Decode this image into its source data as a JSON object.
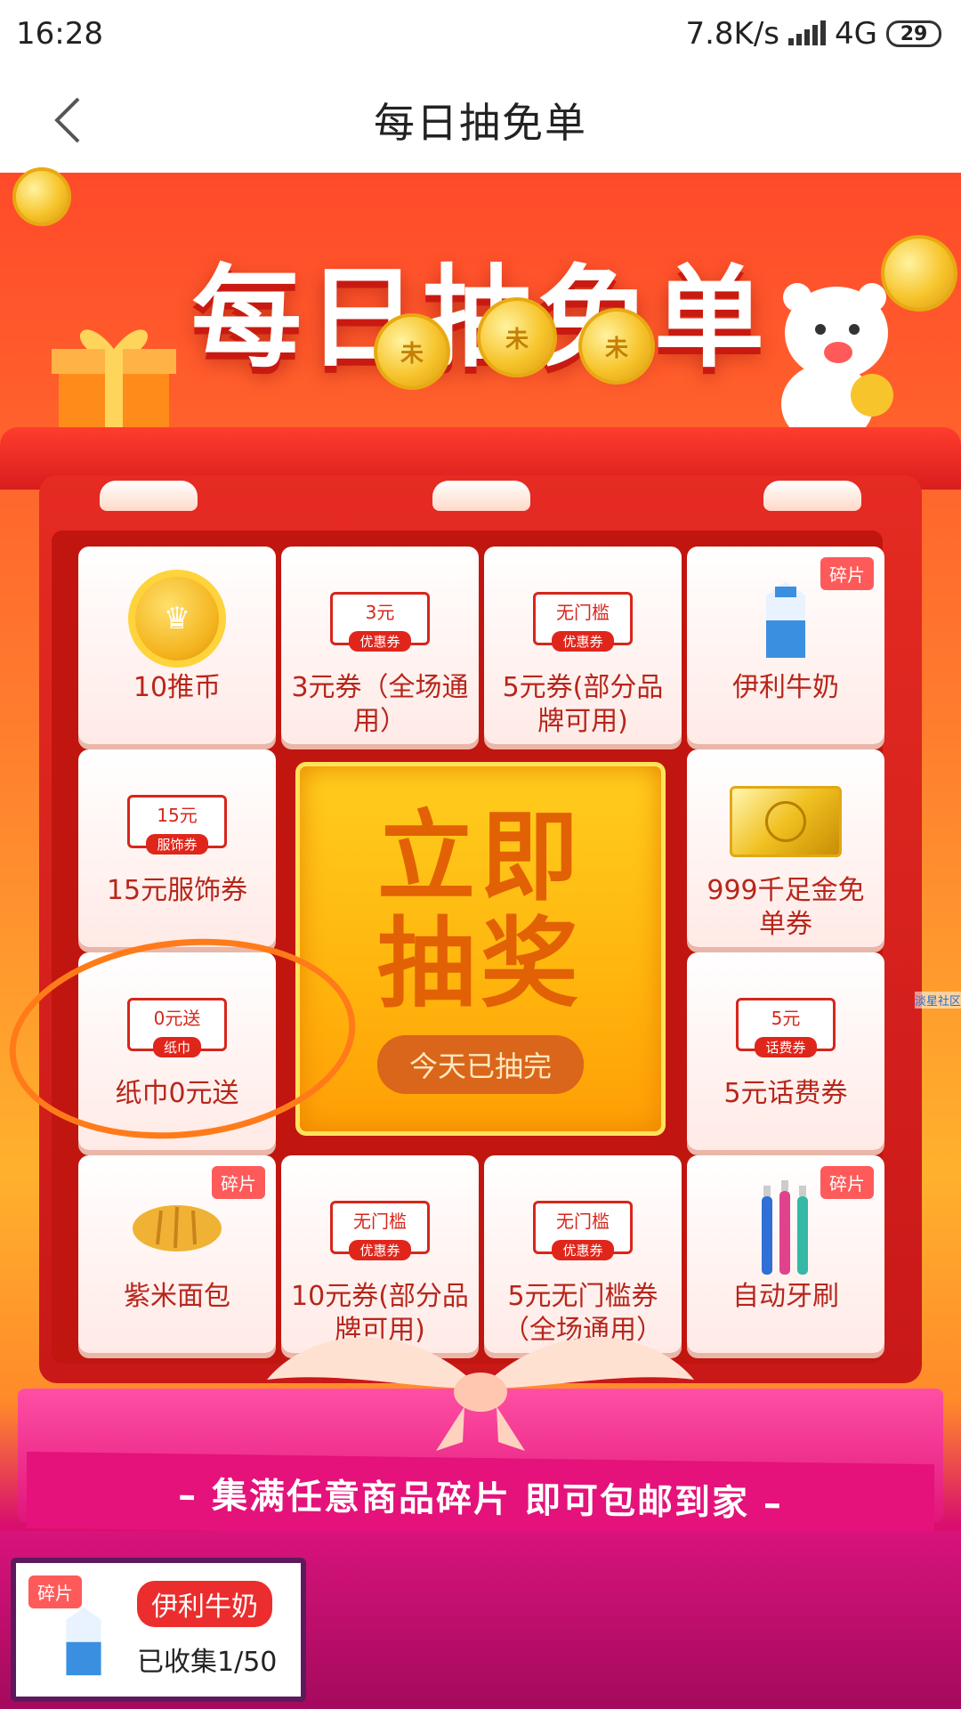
{
  "status_bar": {
    "time": "16:28",
    "speed": "7.8K/s",
    "network": "4G",
    "battery": "29"
  },
  "nav": {
    "title": "每日抽免单"
  },
  "hero": {
    "title": "每日抽免单",
    "coin_mark": "未"
  },
  "center": {
    "line1": "立即",
    "line2": "抽奖",
    "status": "今天已抽完"
  },
  "prizes": [
    {
      "label": "10推币"
    },
    {
      "label": "3元券（全场通用）",
      "ticket_top": "3元",
      "ticket_bottom": "优惠券"
    },
    {
      "label": "5元券(部分品牌可用)",
      "ticket_top": "无门槛",
      "ticket_bottom": "优惠券"
    },
    {
      "label": "伊利牛奶",
      "badge": "碎片"
    },
    {
      "label": "15元服饰券",
      "ticket_top": "15元",
      "ticket_bottom": "服饰券"
    },
    {
      "label": "999千足金免单券"
    },
    {
      "label": "纸巾0元送",
      "ticket_top": "0元送",
      "ticket_bottom": "纸巾"
    },
    {
      "label": "5元话费券",
      "ticket_top": "5元",
      "ticket_bottom": "话费券"
    },
    {
      "label": "紫米面包",
      "badge": "碎片"
    },
    {
      "label": "10元券(部分品牌可用)",
      "ticket_top": "无门槛",
      "ticket_bottom": "优惠券"
    },
    {
      "label": "5元无门槛券（全场通用）",
      "ticket_top": "无门槛",
      "ticket_bottom": "优惠券"
    },
    {
      "label": "自动牙刷",
      "badge": "碎片"
    }
  ],
  "banner": {
    "text": "– 集满任意商品碎片 即可包邮到家 –"
  },
  "collection": {
    "badge": "碎片",
    "name": "伊利牛奶",
    "progress": "已收集1/50"
  },
  "side_mark": "淡星社区",
  "colors": {
    "accent": "#e0261b",
    "gold": "#ffb40d",
    "pink": "#e4127a"
  }
}
